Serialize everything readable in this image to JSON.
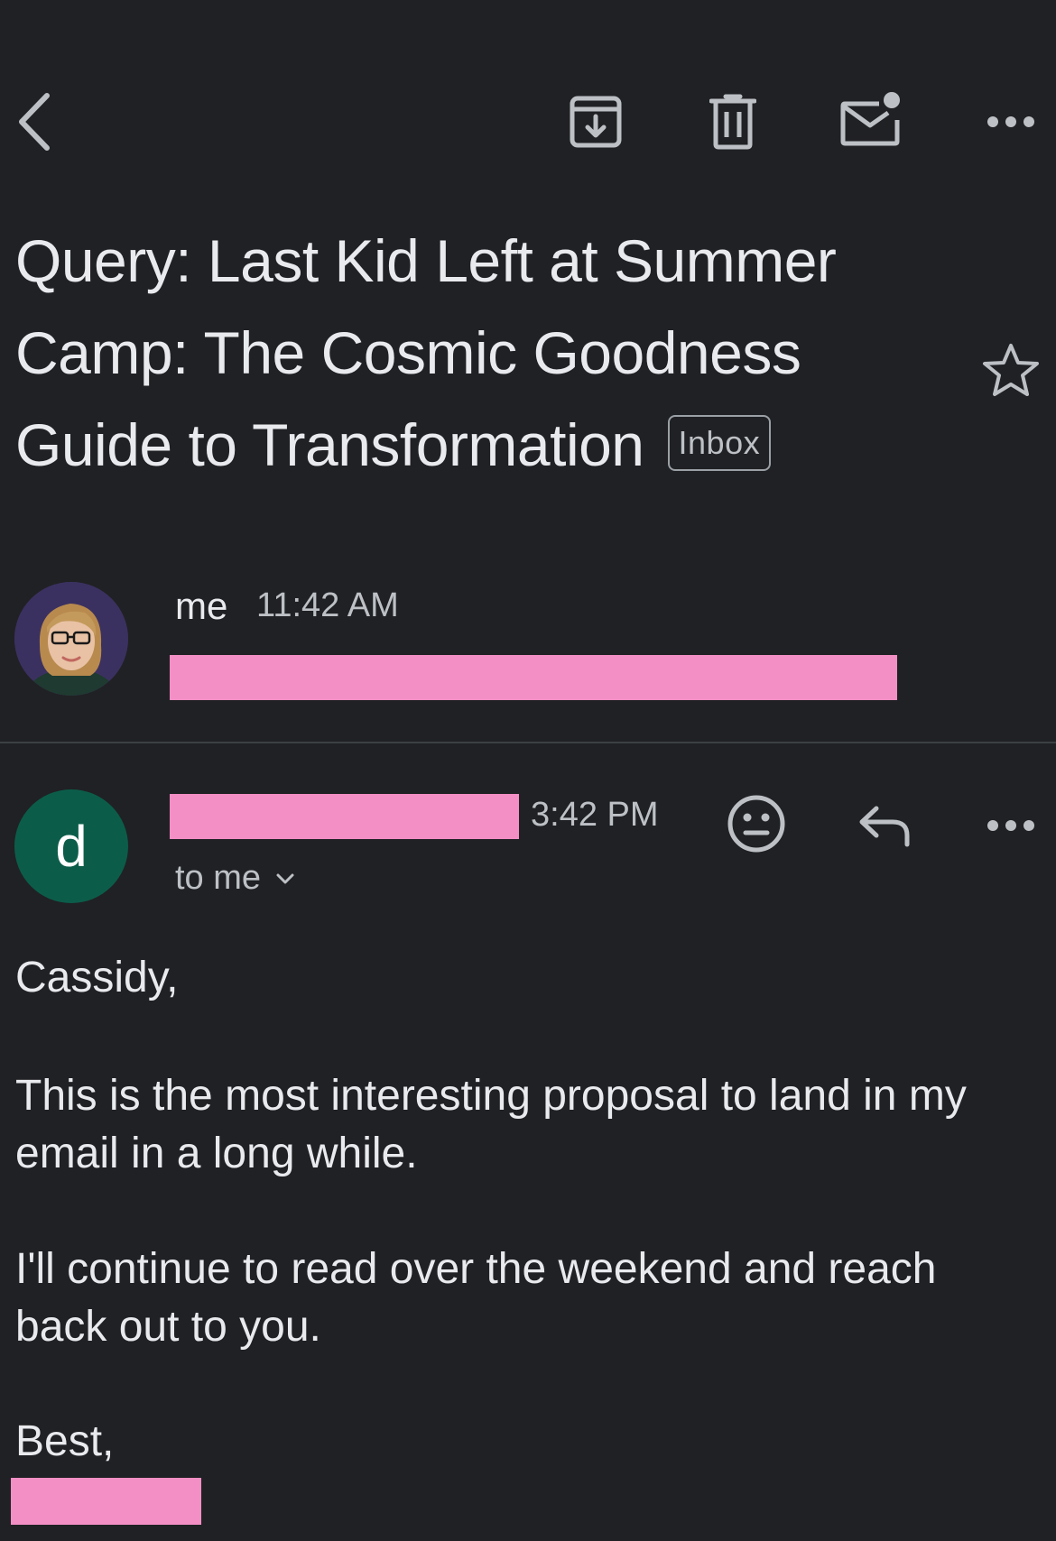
{
  "toolbar": {
    "back_icon": "chevron-left-icon",
    "archive_icon": "archive-icon",
    "delete_icon": "trash-icon",
    "mark_unread_icon": "mark-unread-icon",
    "more_icon": "more-horizontal-icon"
  },
  "subject": {
    "lines": [
      "Query: Last Kid Left at Summer",
      "Camp: The Cosmic Goodness",
      "Guide to Transformation"
    ],
    "label": "Inbox",
    "star_icon": "star-outline-icon"
  },
  "thread": {
    "messages": [
      {
        "sender": "me",
        "time": "11:42 AM",
        "avatar": "profile-photo",
        "snippet_redacted": true
      },
      {
        "sender_redacted": true,
        "avatar_letter": "d",
        "avatar_color": "#0b5d4a",
        "time": "3:42 PM",
        "recipient": "to me",
        "actions": {
          "emoji_icon": "emoji-reaction-icon",
          "reply_icon": "reply-icon",
          "more_icon": "more-horizontal-icon"
        },
        "body": {
          "greeting": "Cassidy,",
          "paragraph_1": "This is the most interesting proposal to land in my email in a long while.",
          "paragraph_2": "I'll continue to read over the weekend and reach back out to you.",
          "signoff": "Best,",
          "signature_redacted": true
        }
      }
    ]
  },
  "colors": {
    "background": "#202124",
    "text_primary": "#e8eaed",
    "text_secondary": "#bdc1c6",
    "redaction": "#f48fc5",
    "divider": "#3c4043"
  }
}
